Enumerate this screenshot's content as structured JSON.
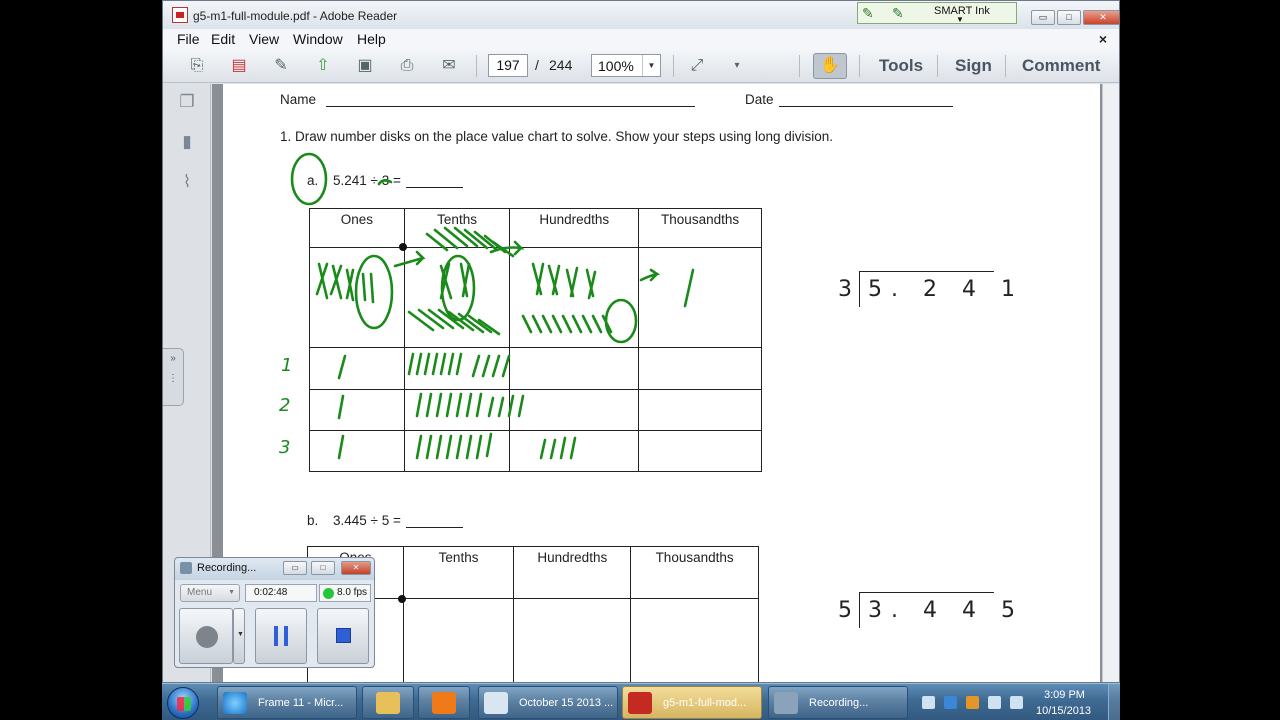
{
  "window": {
    "title": "g5-m1-full-module.pdf - Adobe Reader",
    "smart_ink": "SMART Ink",
    "controls": {
      "minimize": "▭",
      "maximize": "□",
      "close": "✕"
    }
  },
  "menu": {
    "items": [
      "File",
      "Edit",
      "View",
      "Window",
      "Help"
    ],
    "close_doc": "×"
  },
  "toolbar": {
    "page_current": "197",
    "page_separator": "/",
    "page_total": "244",
    "zoom": "100%",
    "tools": "Tools",
    "sign": "Sign",
    "comment": "Comment"
  },
  "page": {
    "name_label": "Name",
    "date_label": "Date",
    "problem_1": "1.   Draw number disks on the place value chart to solve.  Show your steps using long division.",
    "part_a": {
      "label": "a.",
      "expression": "5.241 ÷ 3 =",
      "headers": [
        "Ones",
        "Tenths",
        "Hundredths",
        "Thousandths"
      ],
      "long_division": {
        "divisor": "3",
        "dividend": "5. 2 4 1"
      }
    },
    "part_b": {
      "label": "b.",
      "expression": "3.445 ÷ 5 =",
      "headers": [
        "Ones",
        "Tenths",
        "Hundredths",
        "Thousandths"
      ],
      "long_division": {
        "divisor": "5",
        "dividend": "3. 4 4 5"
      }
    },
    "handwriting": {
      "row_numbers": [
        "1",
        "2",
        "3"
      ],
      "ink_color": "#1a8a1a"
    }
  },
  "recorder": {
    "title": "Recording...",
    "menu": "Menu",
    "time": "0:02:48",
    "fps": "8.0 fps",
    "status_color": "#26c63a"
  },
  "taskbar": {
    "buttons": [
      {
        "label": "Frame 11 - Micr..."
      },
      {
        "label": ""
      },
      {
        "label": ""
      },
      {
        "label": "October 15 2013 ..."
      },
      {
        "label": "g5-m1-full-mod..."
      },
      {
        "label": "Recording..."
      }
    ],
    "clock_time": "3:09 PM",
    "clock_date": "10/15/2013"
  }
}
